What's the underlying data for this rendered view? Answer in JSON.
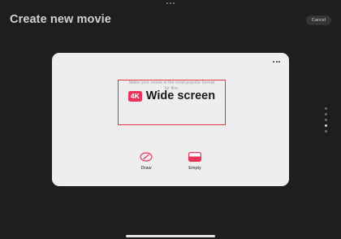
{
  "header": {
    "title": "Create new movie",
    "cancel_label": "Cancel"
  },
  "card": {
    "format": {
      "badge": "4K",
      "title": "Wide screen",
      "description": "Make your movie in the most popular format for film."
    },
    "actions": [
      {
        "label": "Draw",
        "icon": "pencil-circle-icon"
      },
      {
        "label": "Empty",
        "icon": "empty-frame-icon"
      }
    ]
  },
  "pager": {
    "count": 5,
    "active_index": 3
  },
  "colors": {
    "background": "#1e1e1e",
    "card": "#eeeeee",
    "accent": "#e8345b",
    "highlight": "#e0383c"
  }
}
